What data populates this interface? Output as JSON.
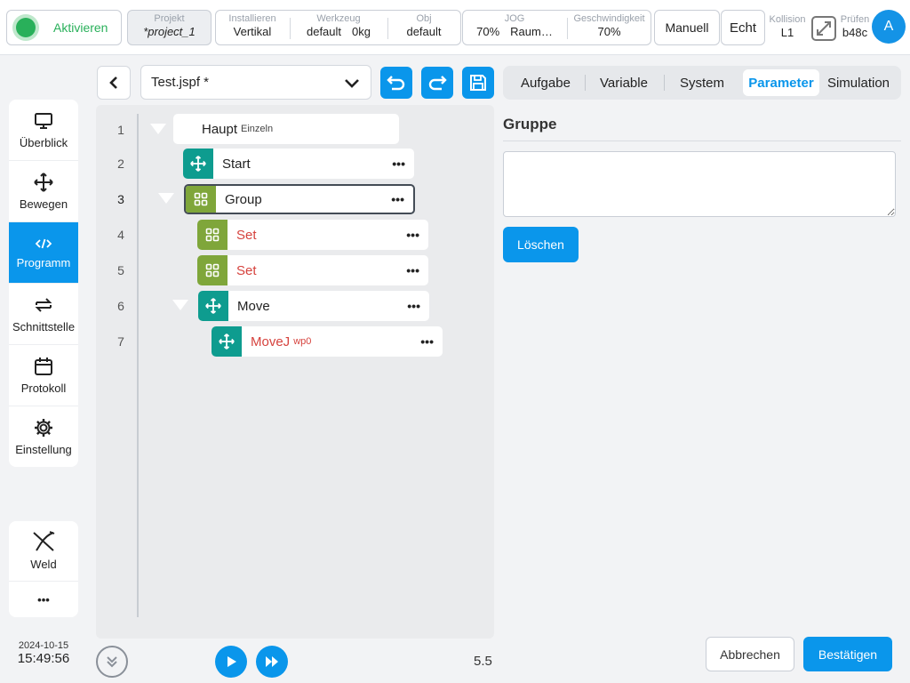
{
  "topbar": {
    "activate_label": "Aktivieren",
    "project": {
      "label": "Projekt",
      "value": "*project_1"
    },
    "install": {
      "label": "Installieren",
      "value": "Vertikal"
    },
    "tool": {
      "label": "Werkzeug",
      "value": "default",
      "weight": "0kg"
    },
    "obj": {
      "label": "Obj",
      "value": "default"
    },
    "jog": {
      "label": "JOG",
      "value": "70%",
      "frame": "Raum…"
    },
    "speed": {
      "label": "Geschwindigkeit",
      "value": "70%"
    },
    "mode_label": "Manuell",
    "real_label": "Echt",
    "collision": {
      "label": "Kollision",
      "value": "L1"
    },
    "check": {
      "label": "Prüfen",
      "value": "b48c"
    },
    "avatar_letter": "A"
  },
  "sidebar": {
    "items": [
      {
        "label": "Überblick",
        "icon": "monitor-icon"
      },
      {
        "label": "Bewegen",
        "icon": "move-arrows-icon"
      },
      {
        "label": "Programm",
        "icon": "code-icon",
        "active": true
      },
      {
        "label": "Schnittstelle",
        "icon": "swap-icon"
      },
      {
        "label": "Protokoll",
        "icon": "calendar-icon"
      },
      {
        "label": "Einstellung",
        "icon": "gear-icon"
      }
    ],
    "extra": [
      {
        "label": "Weld",
        "icon": "weld-icon"
      },
      {
        "label": "•••",
        "icon": "more-icon"
      }
    ],
    "date": "2024-10-15",
    "time": "15:49:56"
  },
  "editor": {
    "file_name": "Test.jspf *",
    "version": "5.5",
    "tree": [
      {
        "line": "1",
        "label": "Haupt",
        "sub": "Einzeln",
        "kind": "root"
      },
      {
        "line": "2",
        "label": "Start",
        "kind": "move"
      },
      {
        "line": "3",
        "label": "Group",
        "kind": "group",
        "selected": true
      },
      {
        "line": "4",
        "label": "Set",
        "kind": "group",
        "error": true
      },
      {
        "line": "5",
        "label": "Set",
        "kind": "group",
        "error": true
      },
      {
        "line": "6",
        "label": "Move",
        "kind": "move"
      },
      {
        "line": "7",
        "label": "MoveJ",
        "sub": "wp0",
        "kind": "move",
        "error": true
      }
    ],
    "more_glyph": "•••"
  },
  "right": {
    "tabs": [
      {
        "label": "Aufgabe"
      },
      {
        "label": "Variable"
      },
      {
        "label": "System"
      },
      {
        "label": "Parameter",
        "active": true
      },
      {
        "label": "Simulation"
      }
    ],
    "section_title": "Gruppe",
    "textarea_value": "",
    "delete_label": "Löschen",
    "cancel_label": "Abbrechen",
    "confirm_label": "Bestätigen"
  },
  "colors": {
    "accent": "#0a96eb",
    "active_green": "#29b05a",
    "move_teal": "#0e9c8f",
    "group_olive": "#7fa63a",
    "error_red": "#d6433e"
  }
}
